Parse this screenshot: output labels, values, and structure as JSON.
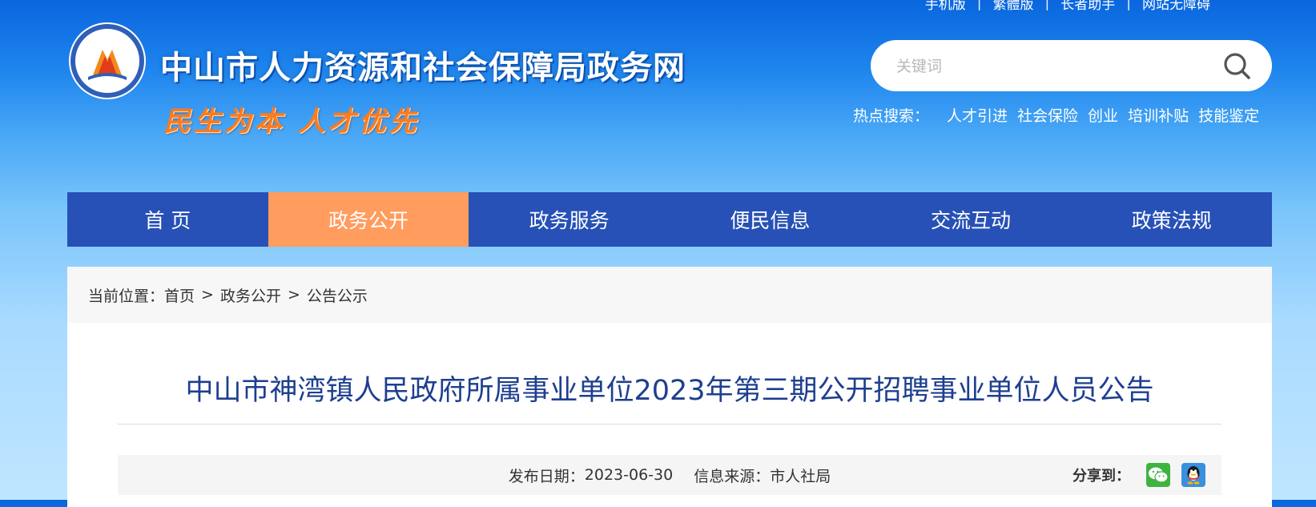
{
  "top_links": [
    "手机版",
    "繁體版",
    "长者助手",
    "网站无障碍"
  ],
  "header": {
    "site_title": "中山市人力资源和社会保障局政务网",
    "slogan": "民生为本 人才优先"
  },
  "search": {
    "placeholder": "关键词",
    "value": ""
  },
  "hot_search": {
    "label": "热点搜索：",
    "items": [
      "人才引进",
      "社会保险",
      "创业",
      "培训补贴",
      "技能鉴定"
    ]
  },
  "nav": {
    "items": [
      {
        "label": "首 页"
      },
      {
        "label": "政务公开",
        "active": true
      },
      {
        "label": "政务服务"
      },
      {
        "label": "便民信息"
      },
      {
        "label": "交流互动"
      },
      {
        "label": "政策法规"
      }
    ]
  },
  "breadcrumb": {
    "prefix": "当前位置：",
    "items": [
      "首页",
      "政务公开",
      "公告公示"
    ],
    "separator": ">"
  },
  "article": {
    "title": "中山市神湾镇人民政府所属事业单位2023年第三期公开招聘事业单位人员公告",
    "publish_date_label": "发布日期：",
    "publish_date": "2023-06-30",
    "source_label": "信息来源：",
    "source": "市人社局",
    "share_label": "分享到："
  },
  "colors": {
    "nav_bg": "#2751b6",
    "nav_active": "#ff9c5e",
    "title_blue": "#1e3f8f",
    "slogan_orange": "#ff7a1a"
  }
}
